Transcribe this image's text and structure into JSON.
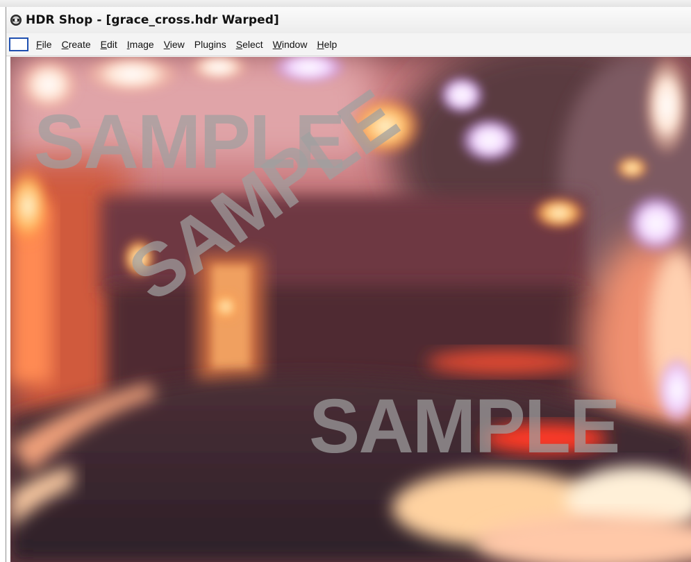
{
  "window": {
    "title": "HDR Shop - [grace_cross.hdr Warped]",
    "icon": "hdr-shop-app-icon"
  },
  "menu": {
    "items": [
      {
        "id": "file",
        "accel": "F",
        "rest": "ile"
      },
      {
        "id": "create",
        "accel": "C",
        "rest": "reate"
      },
      {
        "id": "edit",
        "accel": "E",
        "rest": "dit"
      },
      {
        "id": "image",
        "accel": "I",
        "rest": "mage"
      },
      {
        "id": "view",
        "accel": "V",
        "rest": "iew"
      },
      {
        "id": "plugins",
        "accel": "",
        "rest": "Plugins"
      },
      {
        "id": "select",
        "accel": "S",
        "rest": "elect"
      },
      {
        "id": "window",
        "accel": "W",
        "rest": "indow"
      },
      {
        "id": "help",
        "accel": "H",
        "rest": "elp"
      }
    ]
  },
  "canvas": {
    "watermarks": [
      "SAMPLE",
      "SAMPLE",
      "SAMPLE"
    ]
  },
  "colors": {
    "accent": "#1e4fb0",
    "watermark": "#a0a0a0"
  }
}
